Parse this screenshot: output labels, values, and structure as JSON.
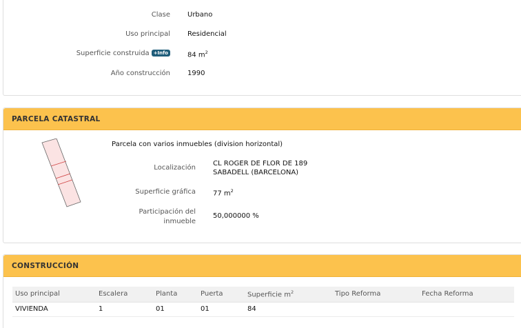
{
  "inmueble": {
    "rows": [
      {
        "label": "Clase",
        "value": "Urbano"
      },
      {
        "label": "Uso principal",
        "value": "Residencial"
      },
      {
        "label": "Superficie construida",
        "value": "84 m",
        "value_sup": "2",
        "badge": "+Info"
      },
      {
        "label": "Año construcción",
        "value": "1990"
      }
    ]
  },
  "parcela": {
    "title": "PARCELA CATASTRAL",
    "description": "Parcela con varios inmuebles (division horizontal)",
    "localizacion_label": "Localización",
    "localizacion_line1": "CL ROGER DE FLOR DE 189",
    "localizacion_line2": "SABADELL (BARCELONA)",
    "superficie_label": "Superficie gráfica",
    "superficie_value": "77 m",
    "superficie_sup": "2",
    "participacion_label_line1": "Participación del",
    "participacion_label_line2": "inmueble",
    "participacion_value": "50,000000 %"
  },
  "construccion": {
    "title": "CONSTRUCCIÓN",
    "columns": [
      "Uso principal",
      "Escalera",
      "Planta",
      "Puerta",
      "Superficie m",
      "Tipo Reforma",
      "Fecha Reforma"
    ],
    "superficie_col_sup": "2",
    "rows": [
      {
        "uso": "VIVIENDA",
        "escalera": "1",
        "planta": "01",
        "puerta": "01",
        "superficie": "84",
        "tipo_reforma": "",
        "fecha_reforma": ""
      }
    ]
  },
  "colors": {
    "header_bg": "#fcc24d",
    "badge_bg": "#1f5d7a",
    "parcel_stroke": "#c0392b",
    "parcel_fill": "#fbe3e3"
  }
}
